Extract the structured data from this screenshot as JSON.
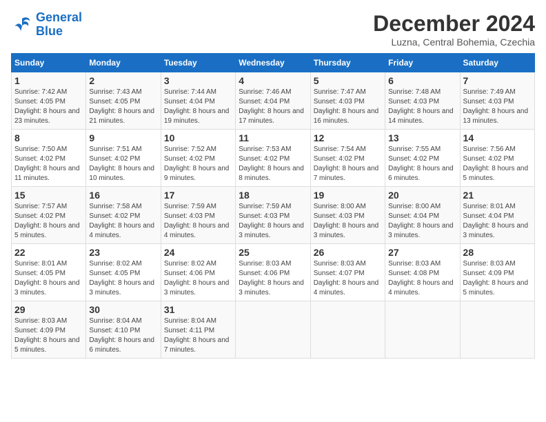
{
  "header": {
    "logo_line1": "General",
    "logo_line2": "Blue",
    "month": "December 2024",
    "location": "Luzna, Central Bohemia, Czechia"
  },
  "weekdays": [
    "Sunday",
    "Monday",
    "Tuesday",
    "Wednesday",
    "Thursday",
    "Friday",
    "Saturday"
  ],
  "weeks": [
    [
      {
        "day": "1",
        "sunrise": "7:42 AM",
        "sunset": "4:05 PM",
        "daylight": "8 hours and 23 minutes."
      },
      {
        "day": "2",
        "sunrise": "7:43 AM",
        "sunset": "4:05 PM",
        "daylight": "8 hours and 21 minutes."
      },
      {
        "day": "3",
        "sunrise": "7:44 AM",
        "sunset": "4:04 PM",
        "daylight": "8 hours and 19 minutes."
      },
      {
        "day": "4",
        "sunrise": "7:46 AM",
        "sunset": "4:04 PM",
        "daylight": "8 hours and 17 minutes."
      },
      {
        "day": "5",
        "sunrise": "7:47 AM",
        "sunset": "4:03 PM",
        "daylight": "8 hours and 16 minutes."
      },
      {
        "day": "6",
        "sunrise": "7:48 AM",
        "sunset": "4:03 PM",
        "daylight": "8 hours and 14 minutes."
      },
      {
        "day": "7",
        "sunrise": "7:49 AM",
        "sunset": "4:03 PM",
        "daylight": "8 hours and 13 minutes."
      }
    ],
    [
      {
        "day": "8",
        "sunrise": "7:50 AM",
        "sunset": "4:02 PM",
        "daylight": "8 hours and 11 minutes."
      },
      {
        "day": "9",
        "sunrise": "7:51 AM",
        "sunset": "4:02 PM",
        "daylight": "8 hours and 10 minutes."
      },
      {
        "day": "10",
        "sunrise": "7:52 AM",
        "sunset": "4:02 PM",
        "daylight": "8 hours and 9 minutes."
      },
      {
        "day": "11",
        "sunrise": "7:53 AM",
        "sunset": "4:02 PM",
        "daylight": "8 hours and 8 minutes."
      },
      {
        "day": "12",
        "sunrise": "7:54 AM",
        "sunset": "4:02 PM",
        "daylight": "8 hours and 7 minutes."
      },
      {
        "day": "13",
        "sunrise": "7:55 AM",
        "sunset": "4:02 PM",
        "daylight": "8 hours and 6 minutes."
      },
      {
        "day": "14",
        "sunrise": "7:56 AM",
        "sunset": "4:02 PM",
        "daylight": "8 hours and 5 minutes."
      }
    ],
    [
      {
        "day": "15",
        "sunrise": "7:57 AM",
        "sunset": "4:02 PM",
        "daylight": "8 hours and 5 minutes."
      },
      {
        "day": "16",
        "sunrise": "7:58 AM",
        "sunset": "4:02 PM",
        "daylight": "8 hours and 4 minutes."
      },
      {
        "day": "17",
        "sunrise": "7:59 AM",
        "sunset": "4:03 PM",
        "daylight": "8 hours and 4 minutes."
      },
      {
        "day": "18",
        "sunrise": "7:59 AM",
        "sunset": "4:03 PM",
        "daylight": "8 hours and 3 minutes."
      },
      {
        "day": "19",
        "sunrise": "8:00 AM",
        "sunset": "4:03 PM",
        "daylight": "8 hours and 3 minutes."
      },
      {
        "day": "20",
        "sunrise": "8:00 AM",
        "sunset": "4:04 PM",
        "daylight": "8 hours and 3 minutes."
      },
      {
        "day": "21",
        "sunrise": "8:01 AM",
        "sunset": "4:04 PM",
        "daylight": "8 hours and 3 minutes."
      }
    ],
    [
      {
        "day": "22",
        "sunrise": "8:01 AM",
        "sunset": "4:05 PM",
        "daylight": "8 hours and 3 minutes."
      },
      {
        "day": "23",
        "sunrise": "8:02 AM",
        "sunset": "4:05 PM",
        "daylight": "8 hours and 3 minutes."
      },
      {
        "day": "24",
        "sunrise": "8:02 AM",
        "sunset": "4:06 PM",
        "daylight": "8 hours and 3 minutes."
      },
      {
        "day": "25",
        "sunrise": "8:03 AM",
        "sunset": "4:06 PM",
        "daylight": "8 hours and 3 minutes."
      },
      {
        "day": "26",
        "sunrise": "8:03 AM",
        "sunset": "4:07 PM",
        "daylight": "8 hours and 4 minutes."
      },
      {
        "day": "27",
        "sunrise": "8:03 AM",
        "sunset": "4:08 PM",
        "daylight": "8 hours and 4 minutes."
      },
      {
        "day": "28",
        "sunrise": "8:03 AM",
        "sunset": "4:09 PM",
        "daylight": "8 hours and 5 minutes."
      }
    ],
    [
      {
        "day": "29",
        "sunrise": "8:03 AM",
        "sunset": "4:09 PM",
        "daylight": "8 hours and 5 minutes."
      },
      {
        "day": "30",
        "sunrise": "8:04 AM",
        "sunset": "4:10 PM",
        "daylight": "8 hours and 6 minutes."
      },
      {
        "day": "31",
        "sunrise": "8:04 AM",
        "sunset": "4:11 PM",
        "daylight": "8 hours and 7 minutes."
      },
      null,
      null,
      null,
      null
    ]
  ]
}
